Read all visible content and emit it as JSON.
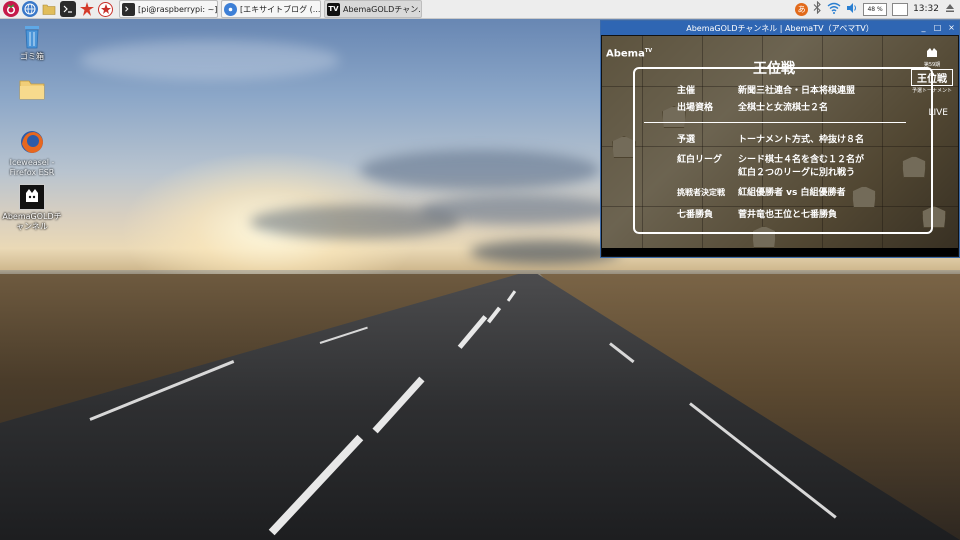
{
  "taskbar": {
    "launchers": [
      {
        "icon": "raspberry-menu-icon",
        "color": "#c51a4a"
      },
      {
        "icon": "globe-browser-icon",
        "color": "#3a78c9"
      },
      {
        "icon": "file-manager-icon",
        "color": "#d9b44a"
      },
      {
        "icon": "terminal-icon",
        "color": "#2b2b2b"
      },
      {
        "icon": "burst-app-icon",
        "color": "#d43a2a"
      },
      {
        "icon": "wolfram-icon",
        "color": "#c8302a"
      }
    ],
    "tasks": [
      {
        "label": "[pi@raspberrypi: ~]",
        "icon": "terminal-icon",
        "color": "#2b2b2b",
        "active": false
      },
      {
        "label": "[エキサイトブログ (...",
        "icon": "chromium-icon",
        "color": "#3d7fd6",
        "active": false
      },
      {
        "label": "AbemaGOLDチャン...",
        "icon": "tv-icon",
        "color": "#111111",
        "active": true
      }
    ],
    "tray": {
      "battery": "48 %",
      "clock": "13:32"
    }
  },
  "desktop_icons": [
    {
      "label": "ゴミ箱",
      "icon": "trash-icon"
    },
    {
      "label": "",
      "icon": "folder-icon"
    },
    {
      "label": "Iceweasel - Firefox ESR",
      "icon": "firefox-icon"
    },
    {
      "label": "AbemaGOLDチャンネル",
      "icon": "abema-icon"
    }
  ],
  "video_window": {
    "title": "AbemaGOLDチャンネル | AbemaTV（アベマTV）",
    "logo": "Abema",
    "logo_sup": "TV",
    "heading": "王位戦",
    "rows": [
      {
        "label": "主催",
        "value": "新聞三社連合・日本将棋連盟"
      },
      {
        "label": "出場資格",
        "value": "全棋士と女流棋士２名"
      },
      {
        "label": "予選",
        "value": "トーナメント方式、枠抜け８名"
      },
      {
        "label": "紅白リーグ",
        "value": "シード棋士４名を含む１２名が"
      },
      {
        "label": "",
        "value": "紅白２つのリーグに別れ戦う"
      },
      {
        "label": "挑戦者決定戦",
        "value": "紅組優勝者 vs 白組優勝者"
      },
      {
        "label": "七番勝負",
        "value": "菅井竜也王位と七番勝負"
      }
    ],
    "badge": {
      "top": "第59期",
      "main": "王位戦",
      "sub": "予選トーナメント"
    },
    "live": "LIVE"
  }
}
